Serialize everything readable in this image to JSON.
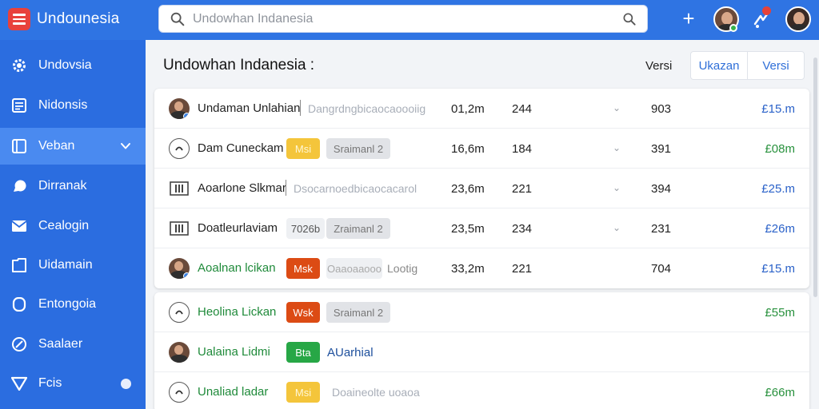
{
  "app": {
    "title": "Undounesia",
    "search_placeholder": "Undowhan Indanesia"
  },
  "sidebar": {
    "items": [
      {
        "label": "Undovsia",
        "icon": "gear-icon"
      },
      {
        "label": "Nidonsis",
        "icon": "document-icon"
      },
      {
        "label": "Veban",
        "icon": "bookmark-icon",
        "active": true
      },
      {
        "label": "Dirranak",
        "icon": "chat-bubble-icon"
      },
      {
        "label": "Cealogin",
        "icon": "mail-icon"
      },
      {
        "label": "Uidamain",
        "icon": "folder-icon"
      },
      {
        "label": "Entongoia",
        "icon": "user-icon"
      },
      {
        "label": "Saalaer",
        "icon": "compass-icon"
      },
      {
        "label": "Fcis",
        "icon": "heart-icon"
      }
    ]
  },
  "header": {
    "title": "Undowhan Indanesia :",
    "versi_label": "Versi",
    "seg_buttons": [
      "Ukazan",
      "Versi"
    ]
  },
  "rows": [
    {
      "name": "Undaman Unlahian",
      "faded": "Dangrdngbicaocaoooiig",
      "v1": "01,2m",
      "v2": "244",
      "v3": "903",
      "amount": "£15.m",
      "amount_color": "blue"
    },
    {
      "name": "Dam Cuneckam",
      "badge1": "Msi",
      "badge2": "Sraimanl 2",
      "v1": "16,6m",
      "v2": "184",
      "v3": "391",
      "amount": "£08m",
      "amount_color": "green"
    },
    {
      "name": "Aoarlone Slkmar",
      "faded": "Dsocarnoedbicaocacarol",
      "v1": "23,6m",
      "v2": "221",
      "v3": "394",
      "amount": "£25.m",
      "amount_color": "blue"
    },
    {
      "name": "Doatleurlaviam",
      "badge1": "7026b",
      "badge2": "Zraimanl 2",
      "v1": "23,5m",
      "v2": "234",
      "v3": "231",
      "amount": "£26m",
      "amount_color": "blue"
    },
    {
      "name": "Aoalnan lcikan",
      "badge1": "Msk",
      "badge2": "Oaaoaaooo",
      "extra": "Lootig",
      "v1": "33,2m",
      "v2": "221",
      "v3": "704",
      "amount": "£15.m",
      "amount_color": "blue"
    }
  ],
  "rows2": [
    {
      "name": "Heolina Lickan",
      "badge1": "Wsk",
      "badge2": "Sraimanl 2",
      "amount": "£55m",
      "amount_color": "green"
    },
    {
      "name": "Ualaina Lidmi",
      "badge1": "Bta",
      "link": "AUarhial"
    },
    {
      "name": "Unaliad ladar",
      "badge1": "Msi",
      "faded": "Doaineolte uoaoa",
      "amount": "£66m",
      "amount_color": "green"
    }
  ]
}
